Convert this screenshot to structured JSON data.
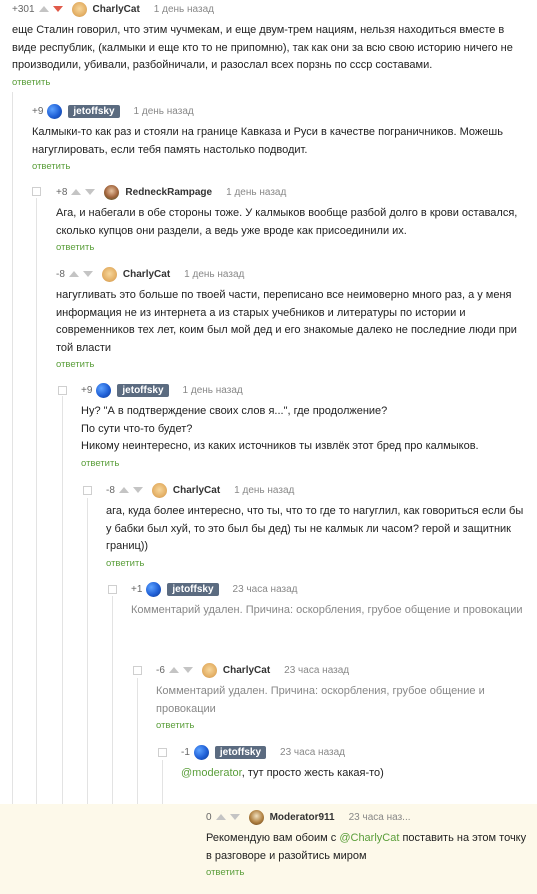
{
  "reply_label": "ответить",
  "comments": [
    {
      "rating": "+301",
      "author": "CharlyCat",
      "time": "1 день назад",
      "text": "еще Сталин говорил, что этим чучмекам,  и еще двум-трем нациям, нельзя находиться вместе в виде республик, (калмыки и еще кто то не припомню), так как они за всю свою историю ничего не производили, убивали, разбойничали, и разослал всех порзнь по ссср составами."
    },
    {
      "rating": "+9",
      "author": "jetoffsky",
      "time": "1 день назад",
      "text": "Калмыки-то как раз и стояли на границе Кавказа и Руси в качестве пограничников. Можешь нагуглировать, если тебя память настолько подводит."
    },
    {
      "rating": "+8",
      "author": "RedneckRampage",
      "time": "1 день назад",
      "text": "Ага, и набегали в обе стороны тоже. У калмыков вообще разбой долго в крови оставался, сколько купцов они раздели, а ведь уже вроде как присоединили их."
    },
    {
      "rating": "-8",
      "author": "CharlyCat",
      "time": "1 день назад",
      "text": "нагугливать это больше по твоей части, переписано все неимоверно много раз, а у меня информация не из интернета а из старых учебников и литературы по истории и современников тех лет, коим был мой дед и его знакомые далеко не последние люди при той власти"
    },
    {
      "rating": "+9",
      "author": "jetoffsky",
      "time": "1 день назад",
      "line1": "Ну? \"А в подтверждение своих слов я...\", где продолжение?",
      "line2": "По сути что-то будет?",
      "line3": "Никому неинтересно, из каких источников ты извлёк этот бред про калмыков."
    },
    {
      "rating": "-8",
      "author": "CharlyCat",
      "time": "1 день назад",
      "text": "ага, куда более интересно, что ты, что то где то нагуглил, как говориться если бы у бабки был хуй, то это был бы дед) ты не калмык ли часом? герой и защитник границ))"
    },
    {
      "rating": "+1",
      "author": "jetoffsky",
      "time": "23 часа назад",
      "text": "Комментарий удален. Причина: оскорбления, грубое общение и провокации"
    },
    {
      "rating": "-6",
      "author": "CharlyCat",
      "time": "23 часа назад",
      "text": "Комментарий удален. Причина: оскорбления, грубое общение и провокации"
    },
    {
      "rating": "-1",
      "author": "jetoffsky",
      "time": "23 часа назад",
      "mention": "@moderator",
      "text_after": ", тут просто жесть какая-то)"
    },
    {
      "rating": "0",
      "author": "Moderator911",
      "time": "23 часа наз...",
      "text_before": "Рекомендую вам обоим с ",
      "mention": "@CharlyCat",
      "text_after": " поставить на этом точку в разговоре и разойтись миром"
    }
  ],
  "colors": {
    "accent": "#5a9e3a",
    "vote_down_active": "#e05a4a",
    "moderator_bg": "#fdf9ea"
  }
}
